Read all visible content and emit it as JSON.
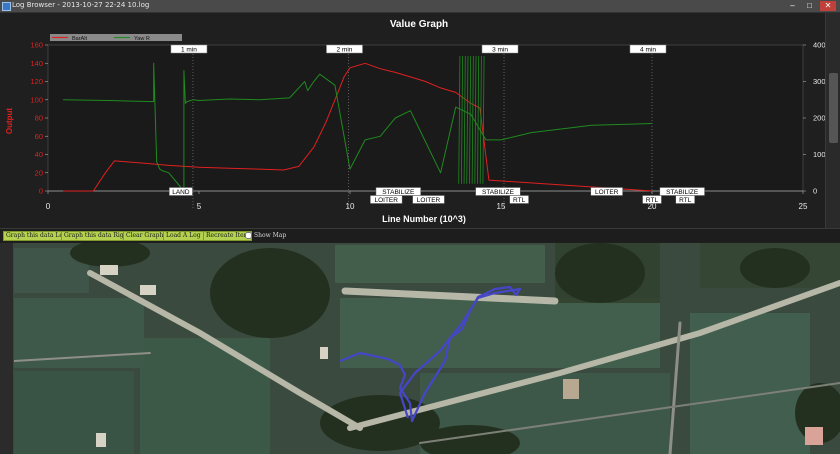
{
  "window": {
    "title": "Log Browser - 2013-10-27 22-24 10.log",
    "minimize_glyph": "–",
    "maximize_glyph": "□",
    "close_glyph": "✕"
  },
  "graph": {
    "title": "Value Graph",
    "y_left_label": "Output",
    "x_label": "Line Number (10^3)",
    "time_markers": [
      {
        "label": "1 min",
        "x": 4.8
      },
      {
        "label": "2 min",
        "x": 9.95
      },
      {
        "label": "3 min",
        "x": 15.1
      },
      {
        "label": "4 min",
        "x": 20.0
      }
    ]
  },
  "chart_data": {
    "type": "line",
    "title": "Value Graph",
    "xlabel": "Line Number (10^3)",
    "ylabel": "Output",
    "xlim": [
      0,
      25
    ],
    "ylim_left": [
      0,
      160
    ],
    "ylim_right": [
      0,
      400
    ],
    "x_ticks": [
      "0",
      "5",
      "10",
      "15",
      "20",
      "25"
    ],
    "y_left_ticks": [
      "0",
      "20",
      "40",
      "60",
      "80",
      "100",
      "120",
      "140",
      "160"
    ],
    "y_right_ticks": [
      "0",
      "100",
      "200",
      "300",
      "400"
    ],
    "grid": "vertical dotted at time markers",
    "legend_position": "top-left",
    "colors": {
      "baralt": "#e02020",
      "yaw": "#1f8a1f"
    },
    "series": [
      {
        "name": "BarAlt",
        "axis": "left",
        "x": [
          0.5,
          1.5,
          1.9,
          2.2,
          3.0,
          4.0,
          5.0,
          6.0,
          7.0,
          7.8,
          8.3,
          8.8,
          9.2,
          9.6,
          9.8,
          10.0,
          10.5,
          11.0,
          11.5,
          12.0,
          12.5,
          13.0,
          13.5,
          14.0,
          14.3,
          14.6,
          20.0
        ],
        "y": [
          0,
          0,
          20,
          33,
          31,
          28,
          26,
          25,
          24,
          23,
          27,
          48,
          75,
          108,
          125,
          135,
          140,
          134,
          130,
          125,
          120,
          113,
          108,
          96,
          91,
          12,
          0
        ]
      },
      {
        "name": "Yaw R",
        "axis": "right",
        "x": [
          0.5,
          2.0,
          3.5,
          3.5,
          3.6,
          3.7,
          3.8,
          4.0,
          4.5,
          4.5,
          4.55,
          4.6,
          4.8,
          5.0,
          6.0,
          7.0,
          8.0,
          8.5,
          8.6,
          8.8,
          9.0,
          9.5,
          10.0,
          10.5,
          11.0,
          11.5,
          12.0,
          13.0,
          13.5,
          14.0,
          14.5,
          15.0,
          16.0,
          18.0,
          20.0
        ],
        "y": [
          250,
          248,
          245,
          350,
          80,
          60,
          55,
          50,
          0,
          330,
          240,
          245,
          250,
          248,
          252,
          250,
          255,
          300,
          275,
          300,
          320,
          290,
          60,
          140,
          150,
          200,
          220,
          50,
          230,
          210,
          140,
          140,
          160,
          180,
          185
        ]
      }
    ],
    "flight_mode_bands": [
      {
        "label": "LAND",
        "x": 4.4
      },
      {
        "label": "STABILIZE",
        "x": 11.6
      },
      {
        "label": "LOITER",
        "x": 11.2
      },
      {
        "label": "LOITER",
        "x": 12.6
      },
      {
        "label": "STABILIZE",
        "x": 14.9
      },
      {
        "label": "RTL",
        "x": 15.6
      },
      {
        "label": "LOITER",
        "x": 18.5
      },
      {
        "label": "RTL",
        "x": 20.0
      },
      {
        "label": "STABILIZE",
        "x": 21.0
      },
      {
        "label": "RTL",
        "x": 21.1
      }
    ]
  },
  "toolbar": {
    "buttons": [
      {
        "label": "Graph this data Left",
        "name": "graph-left-button"
      },
      {
        "label": "Graph this data Right",
        "name": "graph-right-button"
      },
      {
        "label": "Clear Graph",
        "name": "clear-graph-button"
      },
      {
        "label": "Load A Log",
        "name": "load-log-button"
      },
      {
        "label": "Recreate Item",
        "name": "recreate-item-button"
      }
    ],
    "show_map_label": "Show Map",
    "show_map_checked": false
  },
  "map": {
    "track_color": "#3c3cb4"
  }
}
